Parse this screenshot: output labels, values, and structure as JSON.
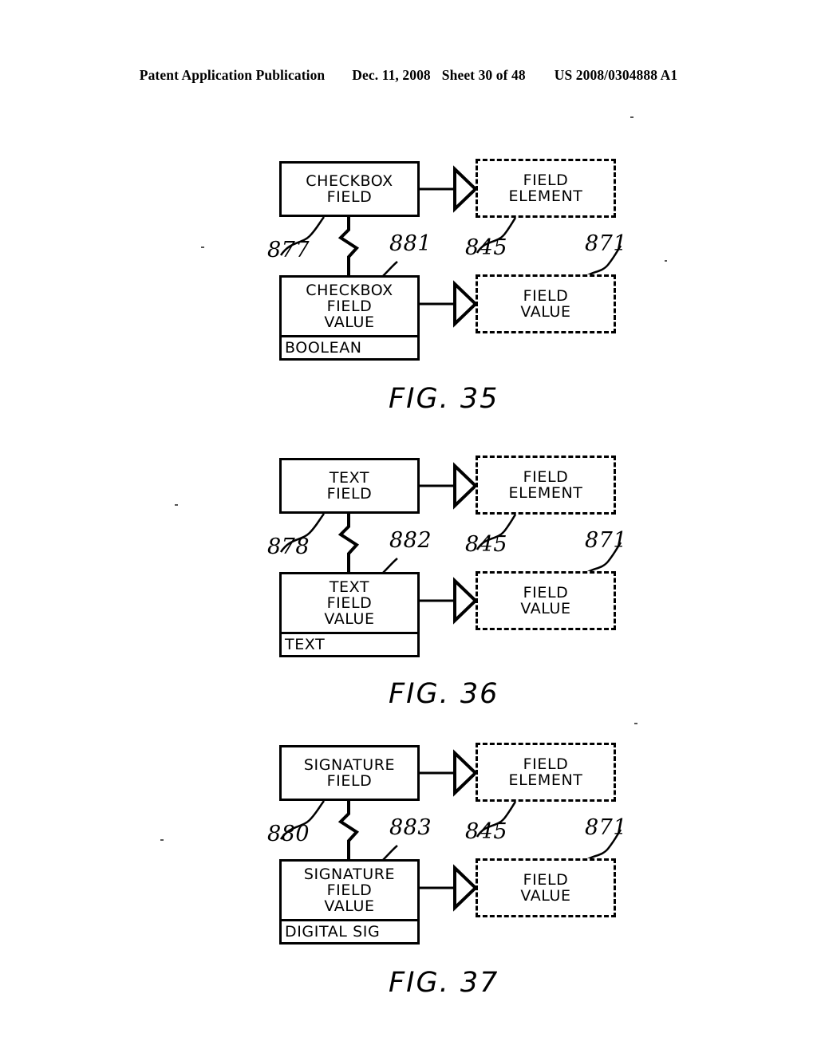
{
  "header": {
    "publication": "Patent Application Publication",
    "date": "Dec. 11, 2008",
    "sheet": "Sheet 30 of 48",
    "number": "US 2008/0304888 A1"
  },
  "figures": [
    {
      "caption": "FIG. 35",
      "field_box": "CHECKBOX\nFIELD",
      "value_box": "CHECKBOX\nFIELD\nVALUE",
      "value_type": "BOOLEAN",
      "element_box": "FIELD\nELEMENT",
      "element_value_box": "FIELD\nVALUE",
      "refs": {
        "field": "877",
        "value": "881",
        "element": "845",
        "element_value": "871"
      }
    },
    {
      "caption": "FIG. 36",
      "field_box": "TEXT\nFIELD",
      "value_box": "TEXT\nFIELD\nVALUE",
      "value_type": "TEXT",
      "element_box": "FIELD\nELEMENT",
      "element_value_box": "FIELD\nVALUE",
      "refs": {
        "field": "878",
        "value": "882",
        "element": "845",
        "element_value": "871"
      }
    },
    {
      "caption": "FIG. 37",
      "field_box": "SIGNATURE\nFIELD",
      "value_box": "SIGNATURE\nFIELD\nVALUE",
      "value_type": "DIGITAL SIG",
      "element_box": "FIELD\nELEMENT",
      "element_value_box": "FIELD\nVALUE",
      "refs": {
        "field": "880",
        "value": "883",
        "element": "845",
        "element_value": "871"
      }
    }
  ],
  "colors": {
    "ink": "#000000",
    "paper": "#ffffff"
  }
}
